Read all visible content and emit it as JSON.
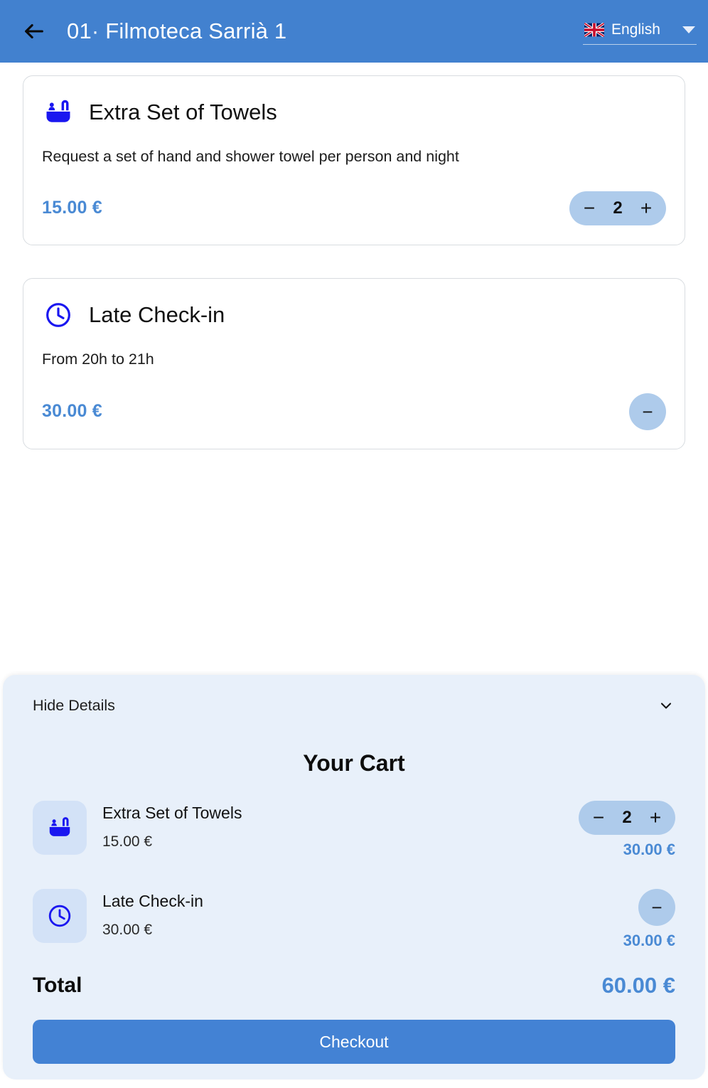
{
  "header": {
    "back_icon": "arrow-left-icon",
    "title": "01· Filmoteca Sarrià 1",
    "language": {
      "flag_icon": "uk-flag-icon",
      "label": "English",
      "caret_icon": "caret-down-icon"
    }
  },
  "services": [
    {
      "icon": "bathtub-icon",
      "title": "Extra Set of Towels",
      "description": "Request a set of hand and shower towel per person and night",
      "price": "15.00 €",
      "control": "stepper",
      "minus_label": "−",
      "quantity": "2",
      "plus_label": "+"
    },
    {
      "icon": "clock-icon",
      "title": "Late Check-in",
      "description": "From 20h to 21h",
      "price": "30.00 €",
      "control": "circle-minus",
      "minus_label": "−"
    }
  ],
  "cart": {
    "toggle_label": "Hide Details",
    "toggle_icon": "chevron-down-icon",
    "title": "Your Cart",
    "items": [
      {
        "icon": "bathtub-icon",
        "name": "Extra Set of Towels",
        "unit_price": "15.00 €",
        "minus_label": "−",
        "quantity": "2",
        "plus_label": "+",
        "line_total": "30.00 €"
      },
      {
        "icon": "clock-icon",
        "name": "Late Check-in",
        "unit_price": "30.00 €",
        "minus_label": "−",
        "line_total": "30.00 €"
      }
    ],
    "total_label": "Total",
    "total_value": "60.00 €",
    "checkout_label": "Checkout"
  },
  "colors": {
    "header_blue": "#4281cf",
    "accent_blue": "#4a8ad4",
    "icon_blue": "#1a17f0",
    "pill_blue": "#aecbeb",
    "tile_blue": "#d3e2f7",
    "cart_bg": "#e8f0fa",
    "button_blue": "#4382d4"
  }
}
